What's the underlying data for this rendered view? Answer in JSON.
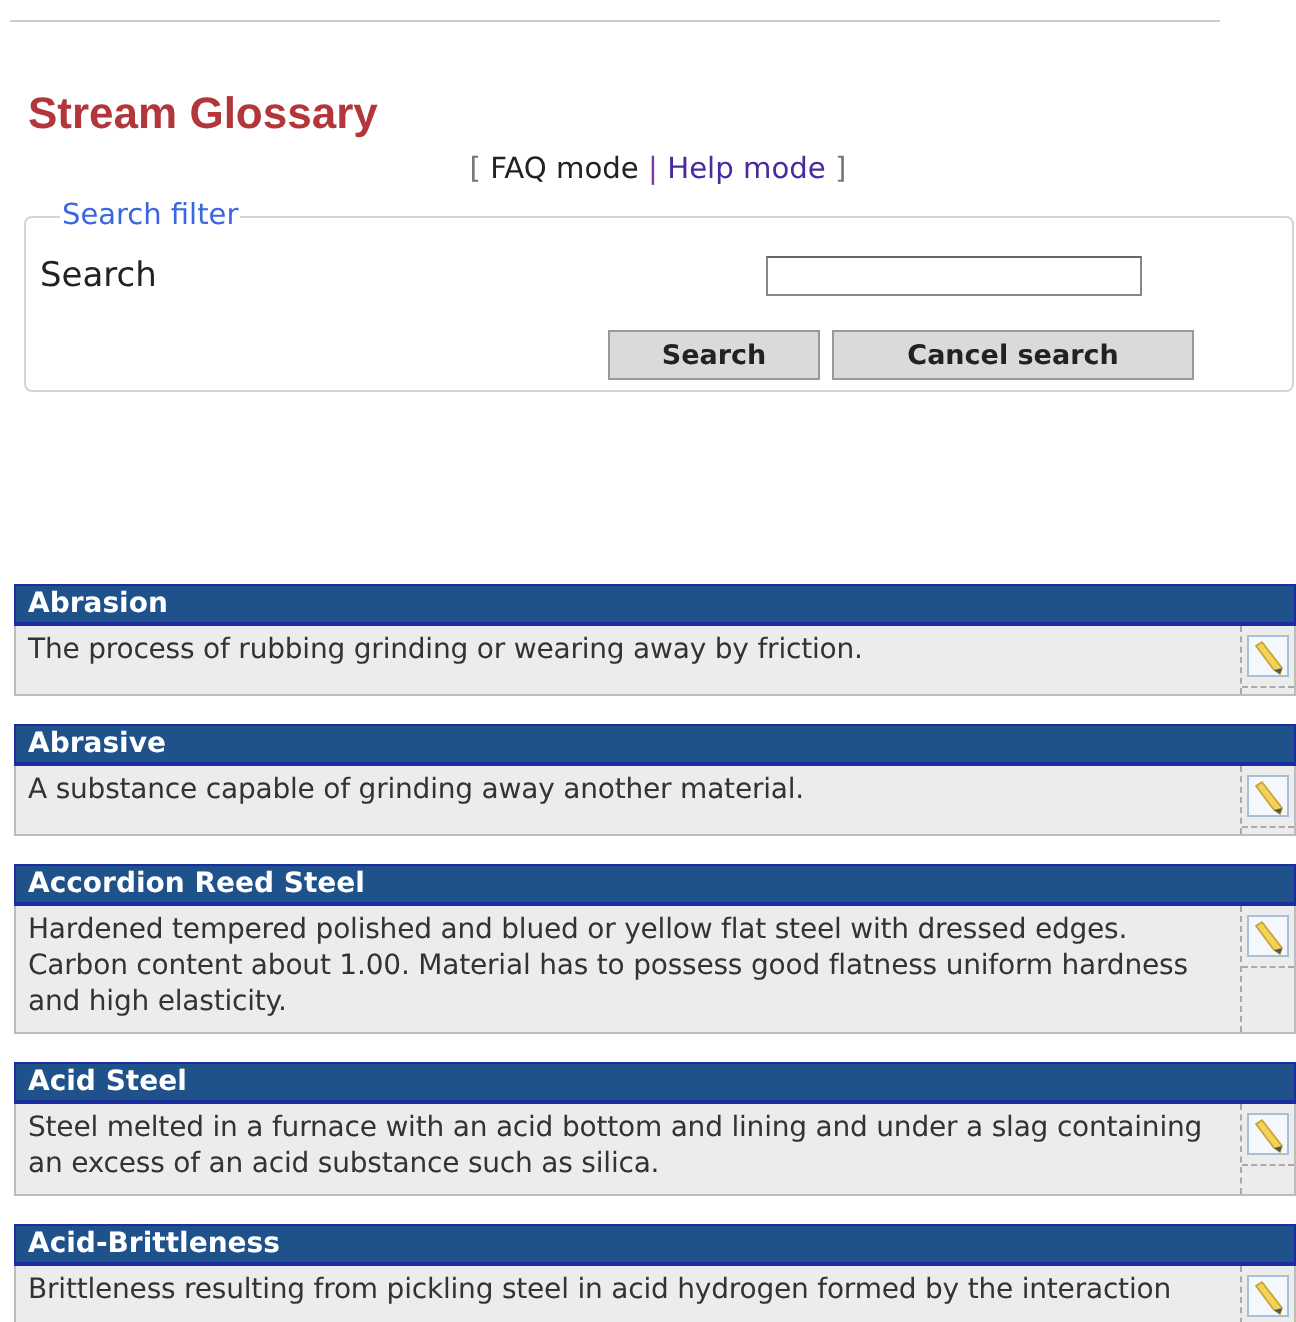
{
  "title": "Stream Glossary",
  "modes_open": "[",
  "modes_separator": "|",
  "modes_close": "]",
  "modes": [
    {
      "label": "FAQ mode",
      "selected": true
    },
    {
      "label": "Help mode",
      "selected": false
    }
  ],
  "search_filter": {
    "legend": "Search filter",
    "label": "Search",
    "buttons": [
      "Search",
      "Cancel search"
    ]
  },
  "entries": [
    {
      "term": "Abrasion",
      "definition": "The process of rubbing grinding or wearing away by friction."
    },
    {
      "term": "Abrasive",
      "definition": "A substance capable of grinding away another material."
    },
    {
      "term": "Accordion Reed Steel",
      "definition": "Hardened tempered polished and blued or yellow flat steel with dressed edges. Carbon content about 1.00. Material has to possess good flatness uniform hardness and high elasticity."
    },
    {
      "term": "Acid Steel",
      "definition": "Steel melted in a furnace with an acid bottom and lining and under a slag containing an excess of an acid substance such as silica."
    },
    {
      "term": "Acid-Brittleness",
      "definition": "Brittleness resulting from pickling steel in acid hydrogen formed by the interaction"
    }
  ]
}
